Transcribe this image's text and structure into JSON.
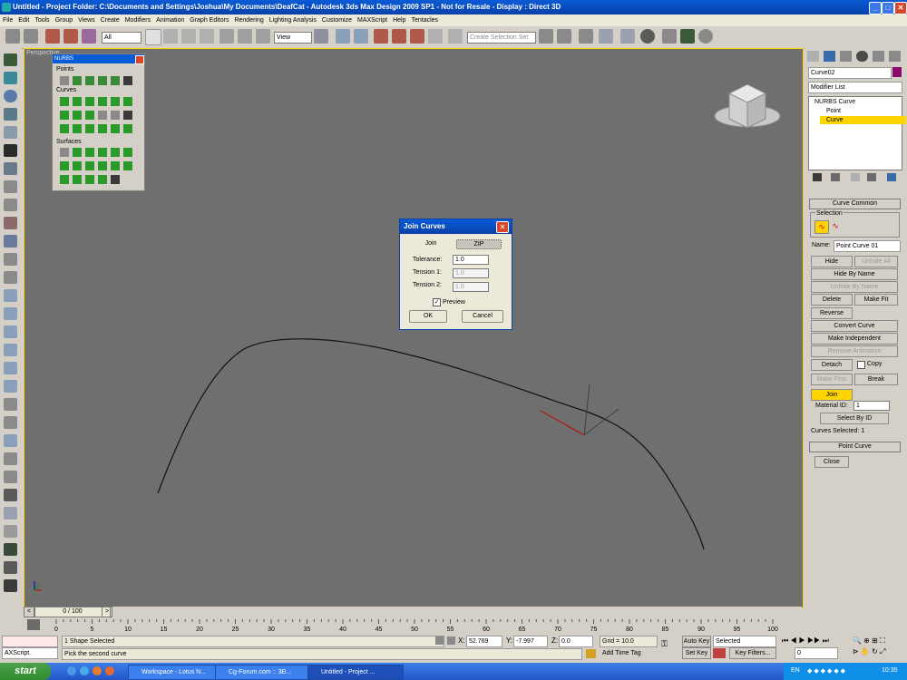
{
  "window": {
    "title": "Untitled     - Project Folder: C:\\Documents and Settings\\Joshua\\My Documents\\DeafCat     - Autodesk 3ds Max Design 2009 SP1     - Not for Resale     - Display : Direct 3D",
    "minimize": "_",
    "maximize": "□",
    "close": "✕"
  },
  "menu": [
    "File",
    "Edit",
    "Tools",
    "Group",
    "Views",
    "Create",
    "Modifiers",
    "Animation",
    "Graph Editors",
    "Rendering",
    "Lighting Analysis",
    "Customize",
    "MAXScript",
    "Help",
    "Tentacles"
  ],
  "toolbar": {
    "filter_value": "All",
    "refcoord_value": "View",
    "selset_placeholder": "Create Selection Set"
  },
  "viewport": {
    "label": "Perspective"
  },
  "nurbs": {
    "title": "NURBS",
    "sections": [
      "Points",
      "Curves",
      "Surfaces"
    ]
  },
  "dialog": {
    "title": "Join Curves",
    "tab_join": "Join",
    "tab_zip": "ZIP",
    "tolerance_label": "Tolerance:",
    "tolerance_value": "1.0",
    "tension1_label": "Tension 1:",
    "tension1_value": "1.0",
    "tension2_label": "Tension 2:",
    "tension2_value": "1.0",
    "preview_label": "Preview",
    "ok_label": "OK",
    "cancel_label": "Cancel"
  },
  "panel": {
    "object_name": "Curve02",
    "modifier_list": "Modifier List",
    "stack": [
      "NURBS Curve",
      "Point",
      "Curve"
    ],
    "rollout_curve_common": "Curve Common",
    "selection_label": "Selection",
    "name_label": "Name:",
    "name_value": "Point Curve 01",
    "hide": "Hide",
    "unhide_all": "Unhide All",
    "hide_by_name": "Hide By Name",
    "unhide_by_name": "Unhide By Name",
    "delete": "Delete",
    "make_fit": "Make Fit",
    "reverse": "Reverse",
    "convert_curve": "Convert Curve",
    "make_independent": "Make Independent",
    "remove_animation": "Remove Animation",
    "detach": "Detach",
    "copy": "Copy",
    "make_first": "Make First",
    "break": "Break",
    "join": "Join",
    "material_id_label": "Material ID:",
    "material_id_value": "1",
    "select_by_id": "Select By ID",
    "curves_selected": "Curves Selected: 1",
    "rollout_point_curve": "Point Curve",
    "close": "Close"
  },
  "timeline": {
    "frame": "0 / 100",
    "ticks": [
      "0",
      "5",
      "10",
      "15",
      "20",
      "25",
      "30",
      "35",
      "40",
      "45",
      "50",
      "55",
      "60",
      "65",
      "70",
      "75",
      "80",
      "85",
      "90",
      "95",
      "100"
    ]
  },
  "status": {
    "maxscript": "AXScript.",
    "selected": "1 Shape Selected",
    "prompt": "Pick the second curve",
    "x_label": "X:",
    "x_value": "52.769",
    "y_label": "Y:",
    "y_value": "-7.997",
    "z_label": "Z:",
    "z_value": "0.0",
    "grid": "Grid = 10.0",
    "add_time_tag": "Add Time Tag",
    "auto_key": "Auto Key",
    "set_key": "Set Key",
    "key_mode": "Selected",
    "key_filters": "Key Filters...",
    "frame_value": "0"
  },
  "taskbar": {
    "start": "start",
    "tasks": [
      "Workspace - Lotus N...",
      "Cg-Forum.com :: 3Ð...",
      "Untitled    - Project ..."
    ],
    "lang": "EN",
    "clock": "10:35"
  }
}
